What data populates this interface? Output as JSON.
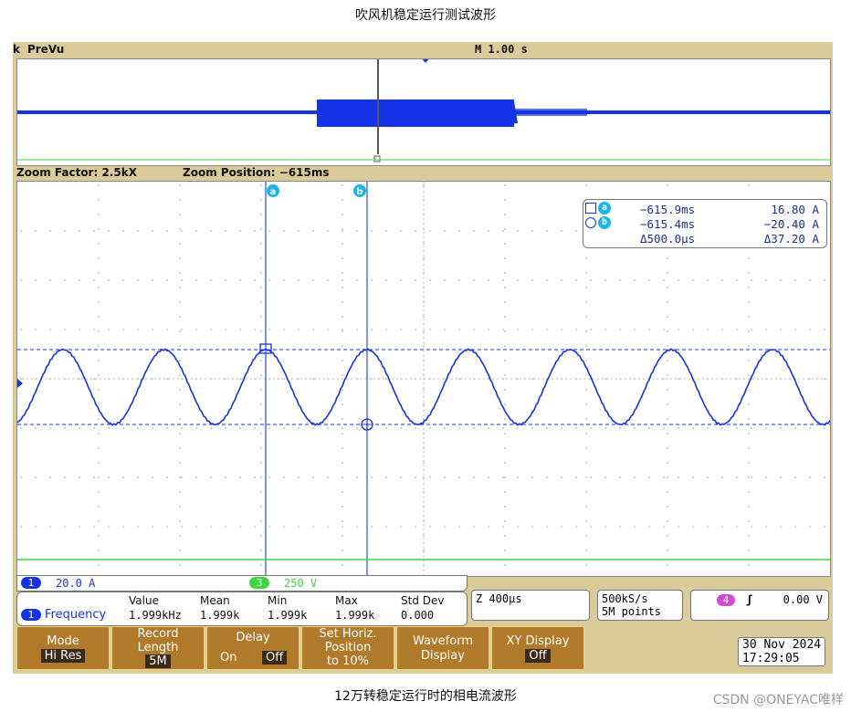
{
  "page": {
    "title": "吹风机稳定运行测试波形",
    "caption": "12万转稳定运行时的相电流波形",
    "watermark": "CSDN @ONEYAC唯样"
  },
  "scope": {
    "topbar": {
      "left": "PreVu",
      "center": "M 1.00 s"
    },
    "zoom": {
      "factor": "Zoom Factor: 2.5kX",
      "position": "Zoom Position: −615ms"
    },
    "cursors": {
      "a_label": "a",
      "b_label": "b",
      "rows": [
        {
          "time": "−615.9ms",
          "value": "16.80 A"
        },
        {
          "time": "−615.4ms",
          "value": "−20.40 A"
        },
        {
          "time": "Δ500.0µs",
          "value": "Δ37.20 A"
        }
      ]
    },
    "channels": {
      "ch1_num": "1",
      "ch1_scale": "20.0 A",
      "ch3_num": "3",
      "ch3_scale": "250 V"
    },
    "measurement": {
      "headers": [
        "Value",
        "Mean",
        "Min",
        "Max",
        "Std Dev"
      ],
      "name": "Frequency",
      "values": [
        "1.999kHz",
        "1.999k",
        "1.999k",
        "1.999k",
        "0.000"
      ]
    },
    "timebase": "Z 400µs",
    "sample": {
      "rate": "500kS/s",
      "points": "5M points"
    },
    "trigger": {
      "ch": "4",
      "level": "0.00 V"
    },
    "buttons": [
      {
        "line1": "Mode",
        "line2": "Hi Res"
      },
      {
        "line1": "Record",
        "line2": "Length",
        "line3": "5M"
      },
      {
        "line1": "Delay",
        "on": "On",
        "off": "Off"
      },
      {
        "line1": "Set Horiz.",
        "line2": "Position",
        "line3": "to 10%"
      },
      {
        "line1": "Waveform",
        "line2": "Display"
      },
      {
        "line1": "XY Display",
        "line2": "Off"
      }
    ],
    "datetime": {
      "date": "30 Nov 2024",
      "time": "17:29:05"
    },
    "colors": {
      "ch1": "#1432e6",
      "ch3": "#3dd63d",
      "ch4": "#d44ad4",
      "cursor_badge": "#19b6e6",
      "bezel": "#d9cc9a",
      "button": "#b07a2a"
    }
  }
}
